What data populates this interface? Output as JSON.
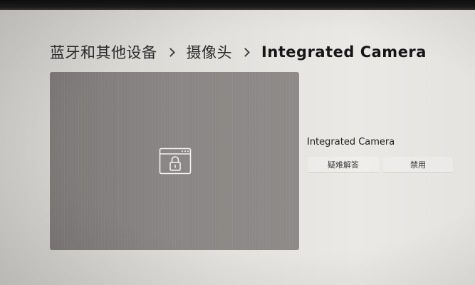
{
  "breadcrumb": {
    "items": [
      "蓝牙和其他设备",
      "摄像头"
    ],
    "current": "Integrated Camera"
  },
  "preview": {
    "state_icon": "camera-blocked-lock-icon"
  },
  "device": {
    "name": "Integrated Camera",
    "actions": {
      "troubleshoot": "疑难解答",
      "disable": "禁用"
    }
  },
  "colors": {
    "preview_bg": "#878382",
    "page_bg": "#e2e0dd"
  }
}
